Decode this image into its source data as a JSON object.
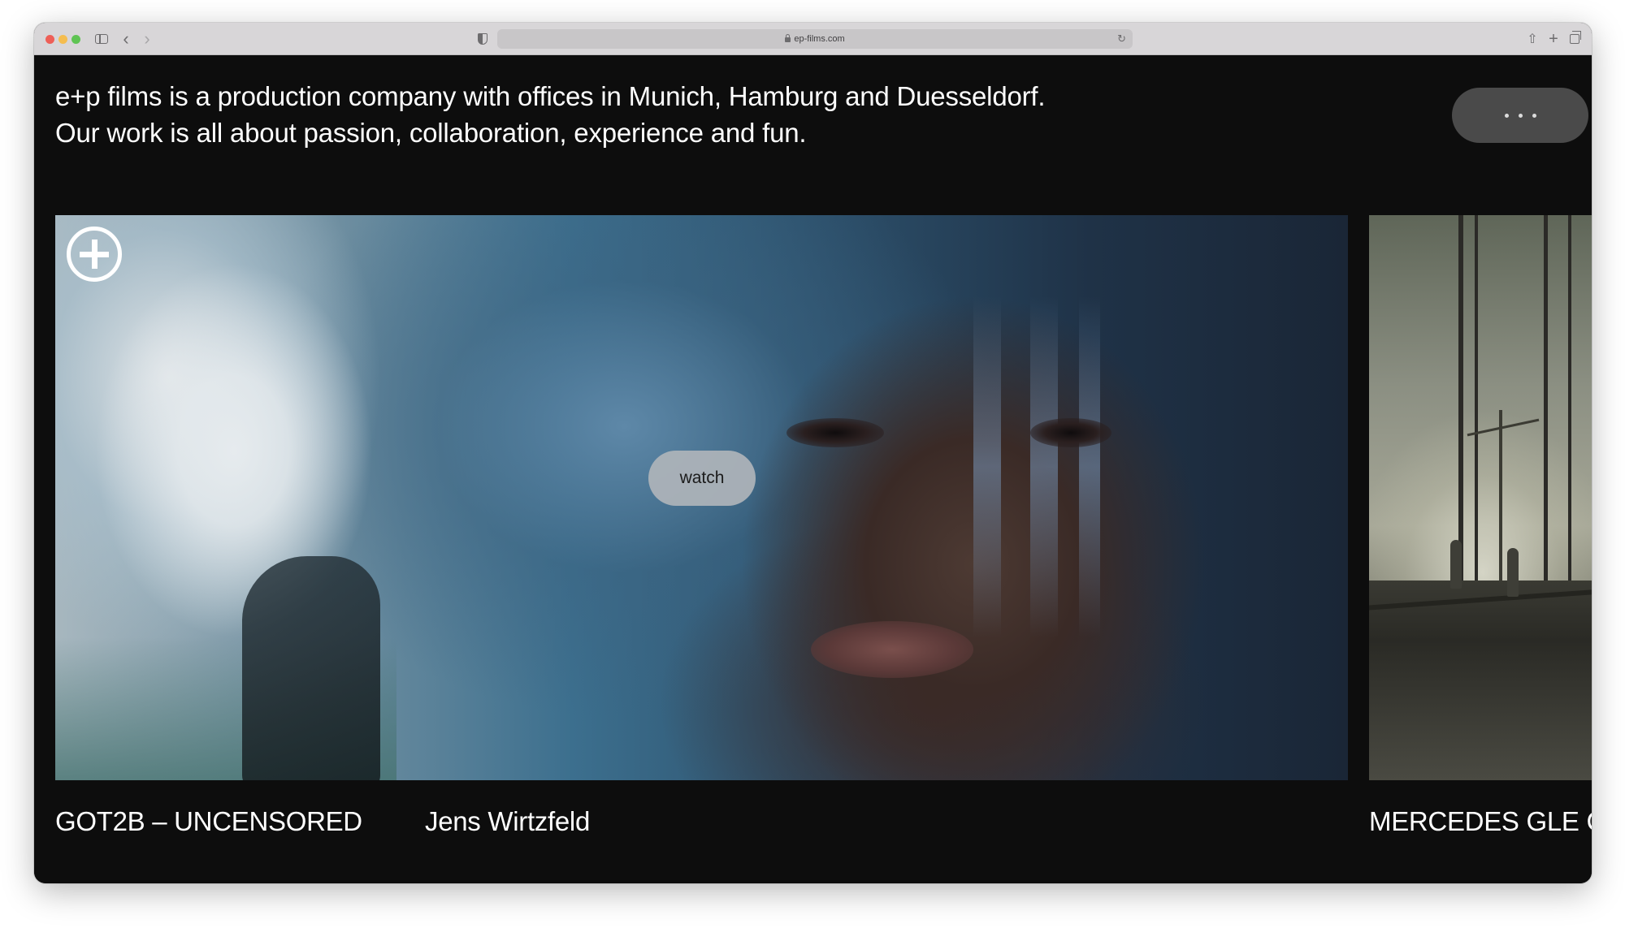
{
  "browser": {
    "url": "ep-films.com"
  },
  "page": {
    "intro_line1": "e+p films is a production company with offices in Munich, Hamburg and Duesseldorf.",
    "intro_line2": "Our work is all about passion, collaboration, experience and fun.",
    "menu_button": {
      "icon": "more-dots-icon"
    }
  },
  "projects": [
    {
      "title": "GOT2B – UNCENSORED",
      "director": "Jens Wirtzfeld",
      "watch_label": "watch",
      "expand_icon": "plus-circle-icon"
    },
    {
      "title": "MERCEDES GLE C"
    }
  ],
  "colors": {
    "background": "#0d0d0d",
    "text": "#ffffff",
    "menu_button": "#4a4a4a",
    "watch_button": "#afb4ba"
  }
}
